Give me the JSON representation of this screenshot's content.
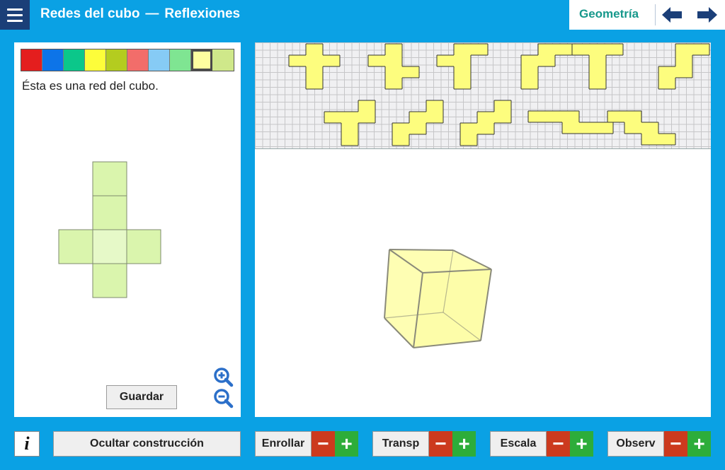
{
  "header": {
    "title": "Redes del cubo",
    "separator": "—",
    "subtitle": "Reflexiones",
    "subject": "Geometría",
    "menu_icon": "hamburger-icon",
    "prev_icon": "arrow-left-icon",
    "next_icon": "arrow-right-icon"
  },
  "palette": {
    "colors": [
      "#e41e1e",
      "#0d74e8",
      "#0bc78a",
      "#fdfd3a",
      "#b4cc1f",
      "#f26d6a",
      "#86cbf5",
      "#7fe592",
      "#fdfda0",
      "#cfe88a"
    ],
    "selected_index": 8
  },
  "left_panel": {
    "description": "Ésta es una red del cubo.",
    "net_color": "#daf5ad",
    "net_center_color": "#e6f9c8",
    "save_label": "Guardar",
    "zoom_in_icon": "zoom-in-icon",
    "zoom_out_icon": "zoom-out-icon"
  },
  "pieces": {
    "color": "#fdfd7e",
    "count": 11
  },
  "cube": {
    "color": "#fdfd9a",
    "edge_color": "#8a8a7a"
  },
  "bottom": {
    "info_label": "i",
    "toggle_label": "Ocultar construcción",
    "controls": [
      {
        "label": "Enrollar"
      },
      {
        "label": "Transp"
      },
      {
        "label": "Escala"
      },
      {
        "label": "Observ"
      }
    ],
    "minus_symbol": "−",
    "plus_symbol": "+"
  }
}
